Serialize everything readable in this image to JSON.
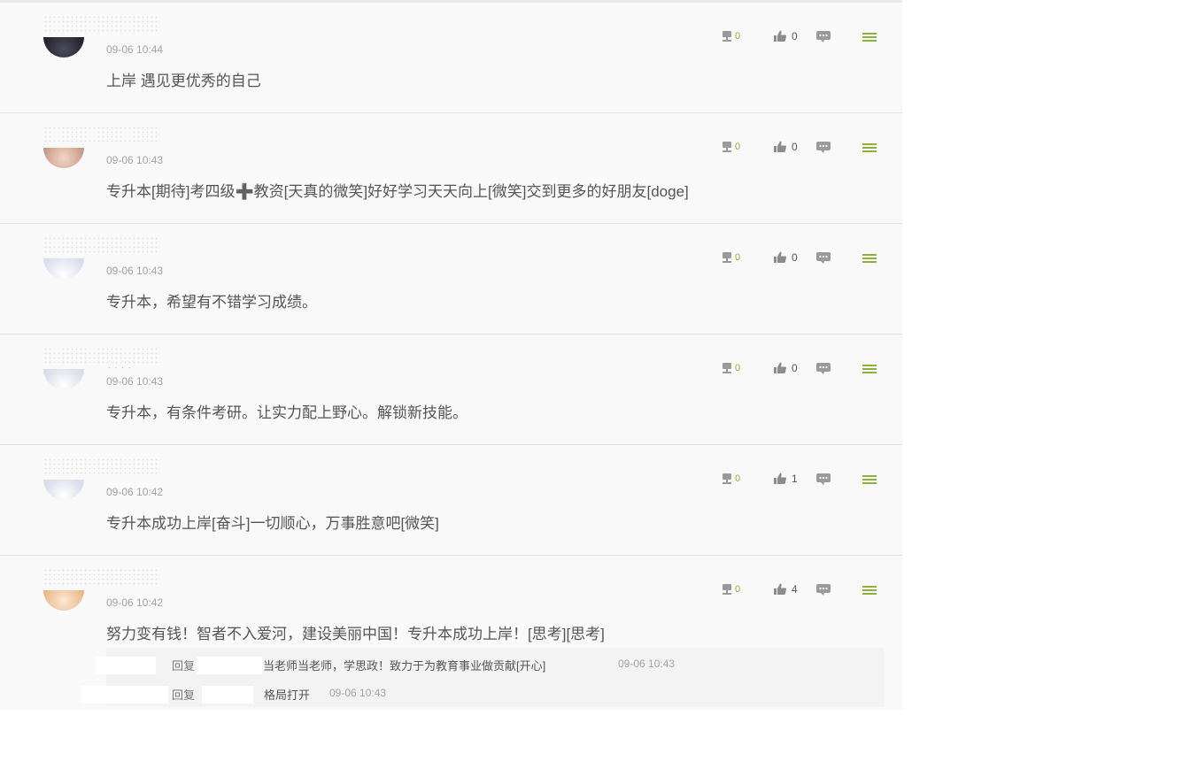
{
  "colors": {
    "accent_green": "#8bb23a",
    "text": "#555555",
    "muted": "#a3a3a3",
    "panel_bg": "#f9f9f9"
  },
  "icons": {
    "gift": "gift-icon",
    "like": "thumbs-up-icon",
    "reply": "speech-bubble-icon",
    "menu": "hamburger-menu-icon"
  },
  "comments": [
    {
      "time": "09-06 10:44",
      "content": "上岸 遇见更优秀的自己",
      "gift_count": "0",
      "like_count": "0"
    },
    {
      "time": "09-06 10:43",
      "content": "专升本[期待]考四级➕教资[天真的微笑]好好学习天天向上[微笑]交到更多的好朋友[doge]",
      "gift_count": "0",
      "like_count": "0"
    },
    {
      "time": "09-06 10:43",
      "content": "专升本，希望有不错学习成绩。",
      "gift_count": "0",
      "like_count": "0"
    },
    {
      "time": "09-06 10:43",
      "content": "专升本，有条件考研。让实力配上野心。解锁新技能。",
      "gift_count": "0",
      "like_count": "0"
    },
    {
      "time": "09-06 10:42",
      "content": "专升本成功上岸[奋斗]一切顺心，万事胜意吧[微笑]",
      "gift_count": "0",
      "like_count": "1"
    },
    {
      "time": "09-06 10:42",
      "content": "努力变有钱！智者不入爱河，建设美丽中国！专升本成功上岸！[思考][思考]",
      "gift_count": "0",
      "like_count": "4",
      "replies": [
        {
          "reply_word": "回复",
          "text": "当老师当老师，学思政！致力于为教育事业做贡献[开心]",
          "time": "09-06 10:43"
        },
        {
          "reply_word": "回复",
          "text": "格局打开",
          "time": "09-06 10:43"
        }
      ]
    }
  ]
}
